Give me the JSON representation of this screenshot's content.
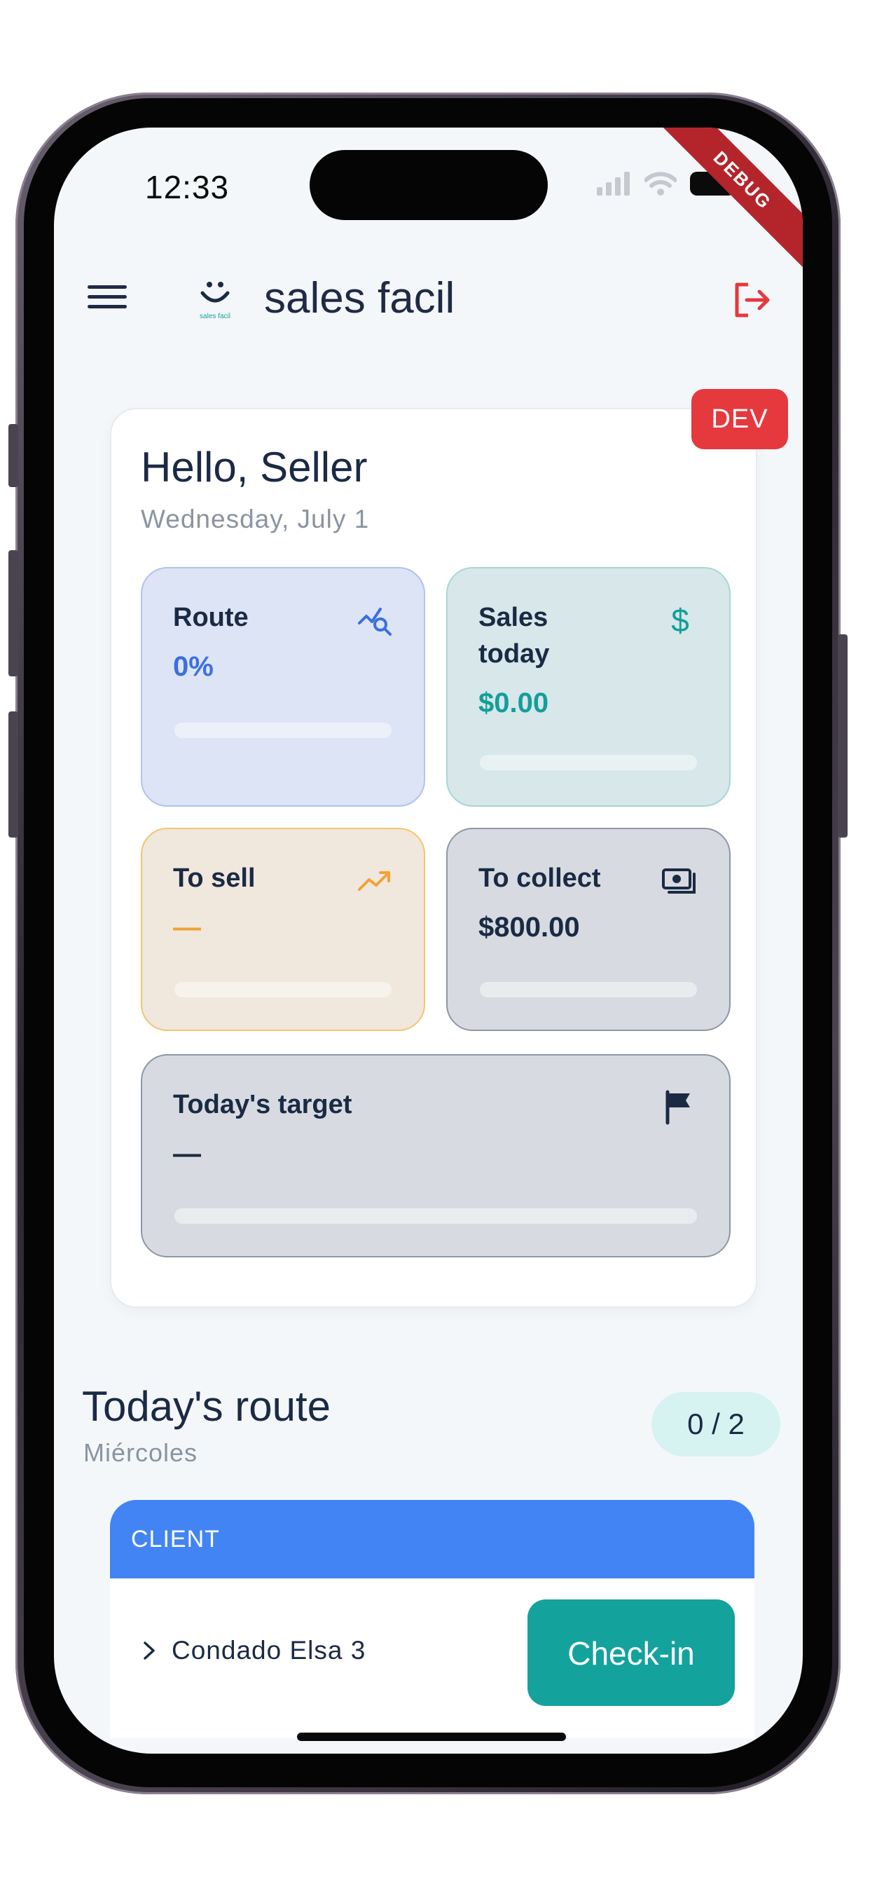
{
  "status_bar": {
    "time": "12:33",
    "debug_banner": "DEBUG"
  },
  "app_bar": {
    "title": "sales facil",
    "logo_text": "sales facil"
  },
  "env_badge": "DEV",
  "summary": {
    "greeting": "Hello, Seller",
    "date": "Wednesday, July 1",
    "tiles": {
      "route": {
        "label": "Route",
        "value": "0%",
        "icon": "route-search-icon",
        "color": "#3b6fe0"
      },
      "sales": {
        "label": "Sales today",
        "value": "$0.00",
        "icon": "dollar-icon",
        "color": "#149e99"
      },
      "to_sell": {
        "label": "To sell",
        "value": "—",
        "icon": "trending-up-icon",
        "color": "#f2a23a"
      },
      "to_collect": {
        "label": "To collect",
        "value": "$800.00",
        "icon": "cash-icon",
        "color": "#1b2a44"
      },
      "target": {
        "label": "Today's target",
        "value": "—",
        "icon": "flag-icon",
        "color": "#1b2a44"
      }
    }
  },
  "route": {
    "title": "Today's route",
    "day": "Miércoles",
    "count": "0 / 2",
    "table_header": "CLIENT",
    "clients": [
      {
        "name": "Condado Elsa 3",
        "action": "Check-in"
      }
    ]
  }
}
